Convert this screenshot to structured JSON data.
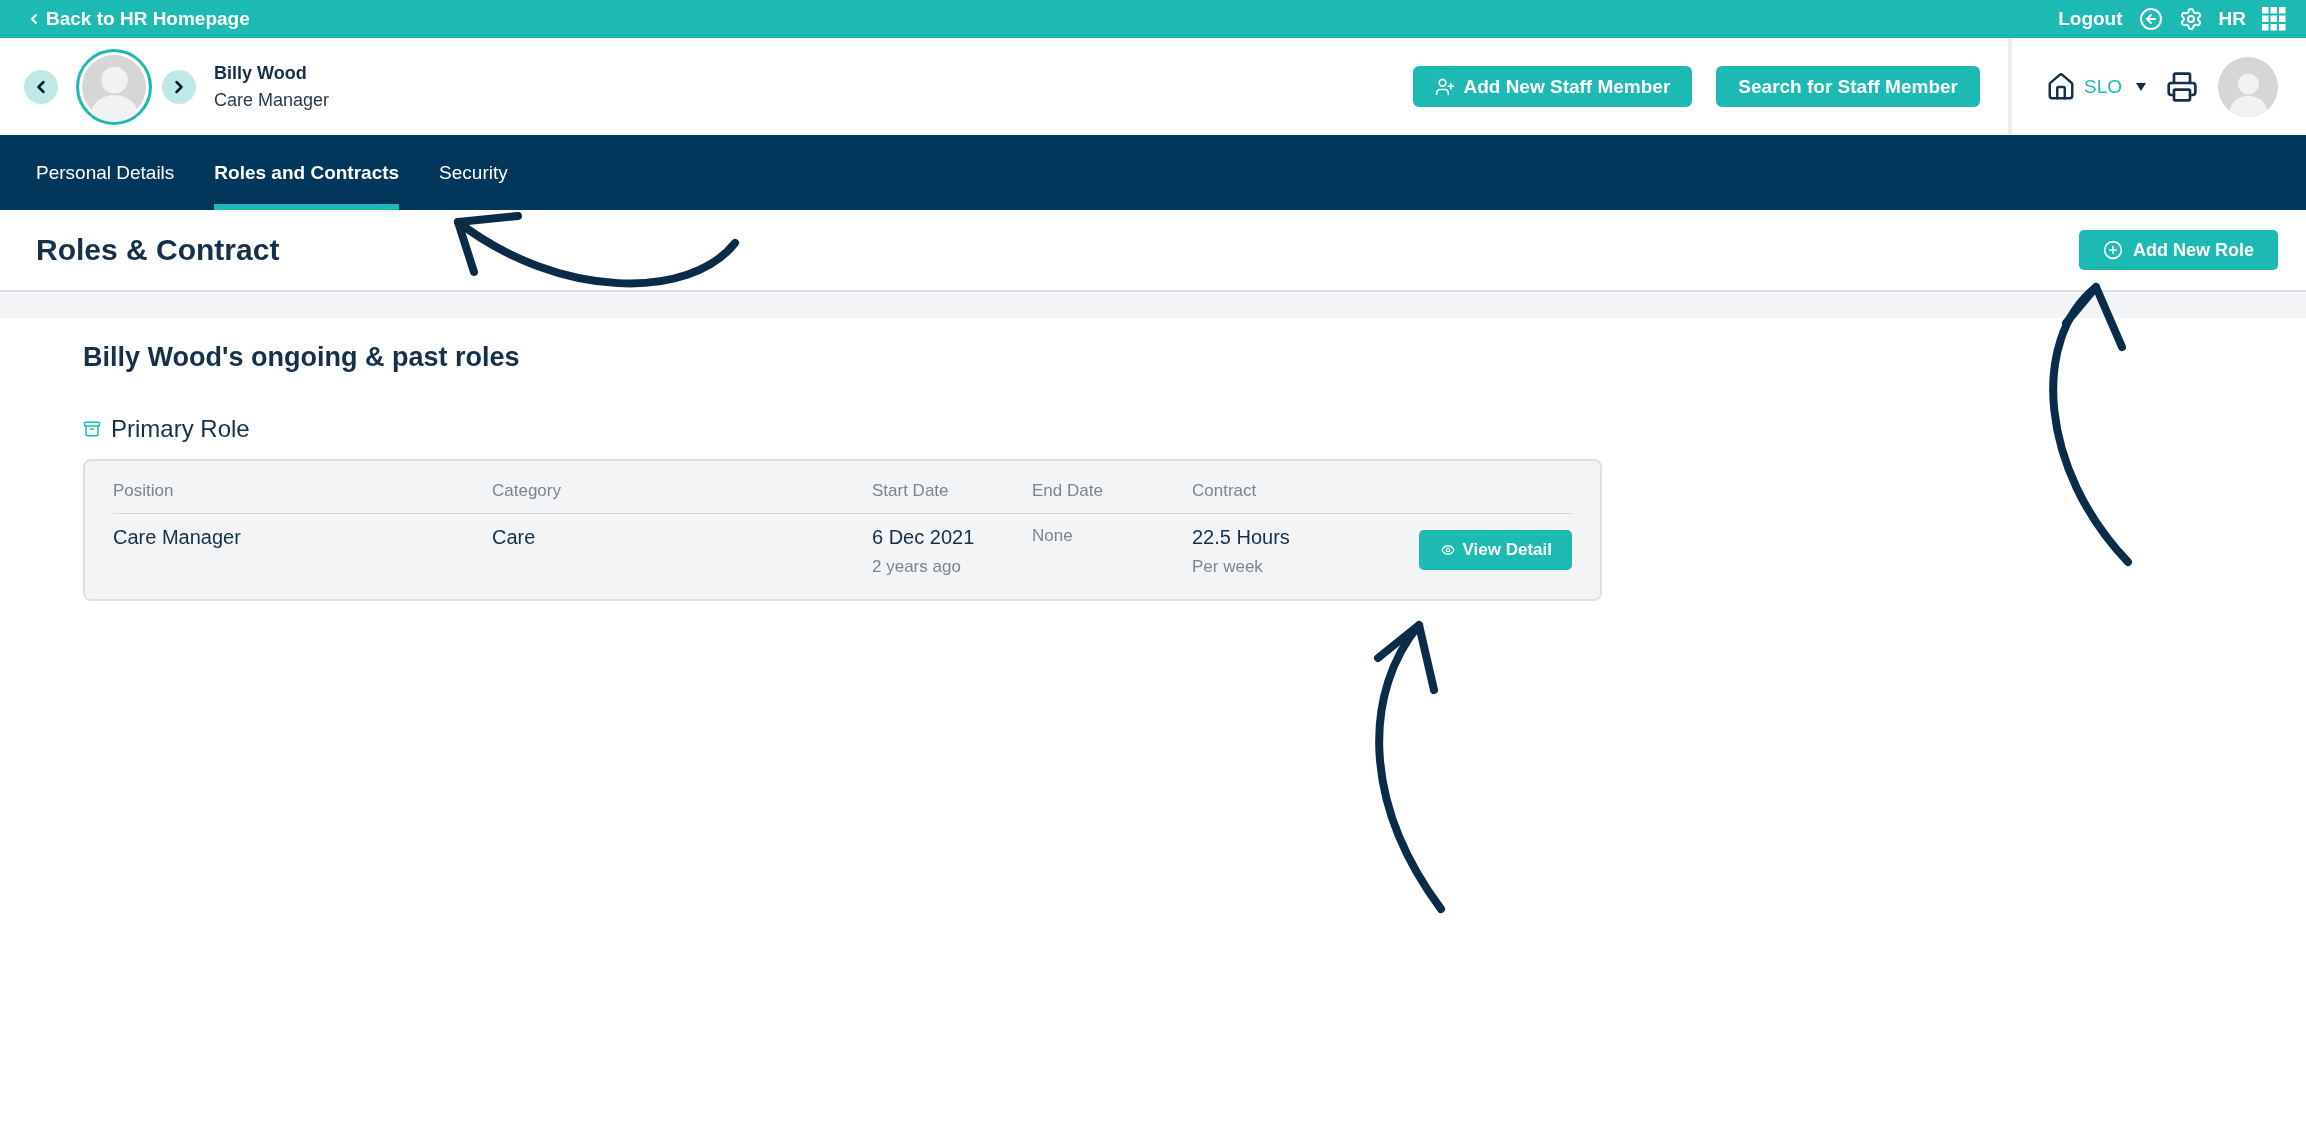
{
  "top_bar": {
    "back_link": "Back to HR Homepage",
    "logout": "Logout",
    "user_initials": "HR"
  },
  "staff": {
    "name": "Billy Wood",
    "role": "Care Manager"
  },
  "header_buttons": [
    {
      "label": "Add New Staff Member",
      "kind": "add"
    },
    {
      "label": "Search for Staff Member",
      "kind": "plain"
    }
  ],
  "location": {
    "label": "SLO"
  },
  "tabs": [
    {
      "label": "Personal Details",
      "selected": false
    },
    {
      "label": "Roles and Contracts",
      "selected": true
    },
    {
      "label": "Security",
      "selected": false
    }
  ],
  "page": {
    "title": "Roles & Contract",
    "add_button": "Add New Role"
  },
  "section_title": "Billy Wood's ongoing & past roles",
  "primary_role": {
    "title": "Primary Role",
    "columns": [
      "Position",
      "Category",
      "Start Date",
      "End Date",
      "Contract"
    ],
    "rows": [
      {
        "position": "Care Manager",
        "category": "Care",
        "start_date": "6 Dec 2021",
        "start_ago": "2 years ago",
        "end_date": "None",
        "contract": "22.5 Hours",
        "contract_unit": "Per week",
        "action": "View Detail"
      }
    ]
  }
}
